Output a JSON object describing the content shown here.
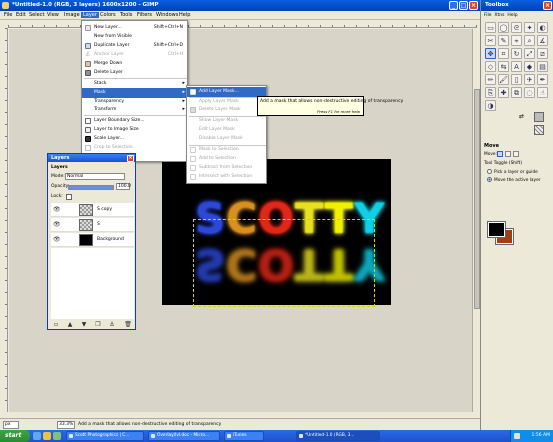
{
  "window": {
    "title": "*Untitled-1.0 (RGB, 3 layers) 1600x1200 - GIMP"
  },
  "menubar": [
    "File",
    "Edit",
    "Select",
    "View",
    "Image",
    "Layer",
    "Colors",
    "Tools",
    "Filters",
    "Windows",
    "Help"
  ],
  "layer_menu": {
    "new_layer": {
      "label": "New Layer...",
      "shortcut": "Shift+Ctrl+N"
    },
    "new_from_visible": {
      "label": "New from Visible"
    },
    "duplicate_layer": {
      "label": "Duplicate Layer",
      "shortcut": "Shift+Ctrl+D"
    },
    "anchor_layer": {
      "label": "Anchor Layer",
      "shortcut": "Ctrl+H"
    },
    "merge_down": {
      "label": "Merge Down"
    },
    "delete_layer": {
      "label": "Delete Layer"
    },
    "stack": {
      "label": "Stack"
    },
    "mask": {
      "label": "Mask"
    },
    "transparency": {
      "label": "Transparency"
    },
    "transform": {
      "label": "Transform"
    },
    "layer_boundary_size": {
      "label": "Layer Boundary Size..."
    },
    "layer_to_image_size": {
      "label": "Layer to Image Size"
    },
    "scale_layer": {
      "label": "Scale Layer..."
    },
    "crop_to_selection": {
      "label": "Crop to Selection"
    },
    "autocrop_layer": {
      "label": "Autocrop Layer"
    }
  },
  "mask_menu": {
    "add_layer_mask": "Add Layer Mask...",
    "apply_layer_mask": "Apply Layer Mask",
    "delete_layer_mask": "Delete Layer Mask",
    "show_layer_mask": "Show Layer Mask",
    "edit_layer_mask": "Edit Layer Mask",
    "disable_layer_mask": "Disable Layer Mask",
    "mask_to_selection": "Mask to Selection",
    "add_to_selection": "Add to Selection",
    "subtract_from_selection": "Subtract from Selection",
    "intersect_with_selection": "Intersect with Selection"
  },
  "tooltip": {
    "text": "Add a mask that allows non-destructive editing of transparency",
    "help": "Press F1 for more help"
  },
  "canvas": {
    "text": "SCOTTY",
    "letter_colors": [
      "#2c48d8",
      "#d89020",
      "#e02818",
      "#e8e020",
      "#f0f000",
      "#10d0e8"
    ],
    "background": "#000000"
  },
  "statusbar": {
    "unit": "px",
    "zoom": "33.3%",
    "message": "Add a mask that allows non-destructive editing of transparency"
  },
  "layers_dialog": {
    "title": "Layers",
    "subtitle": "Layers",
    "mode_label": "Mode:",
    "mode_value": "Normal",
    "opacity_label": "Opacity:",
    "opacity_value": "100.0",
    "lock_label": "Lock:",
    "layers": [
      {
        "name": "S copy",
        "visible": true,
        "thumb": "checker"
      },
      {
        "name": "S",
        "visible": true,
        "thumb": "checker"
      },
      {
        "name": "Background",
        "visible": true,
        "thumb": "black"
      }
    ]
  },
  "toolbox": {
    "title": "Toolbox",
    "menus": [
      "File",
      "Xtns",
      "Help"
    ],
    "fg_color": "#000000",
    "bg_color": "#a04010",
    "tool_options_title": "Move",
    "move_label": "Move:",
    "tool_toggle_label": "Tool Toggle  (Shift)",
    "opt_pick": "Pick a layer or guide",
    "opt_move": "Move the active layer"
  },
  "taskbar": {
    "start": "start",
    "tasks": [
      "Scott Photographics | C...",
      "Overlay/lvl.doc - Micro...",
      "iTunes",
      "*Untitled-1.0 (RGB, 3..."
    ],
    "time": "1:56 AM"
  }
}
